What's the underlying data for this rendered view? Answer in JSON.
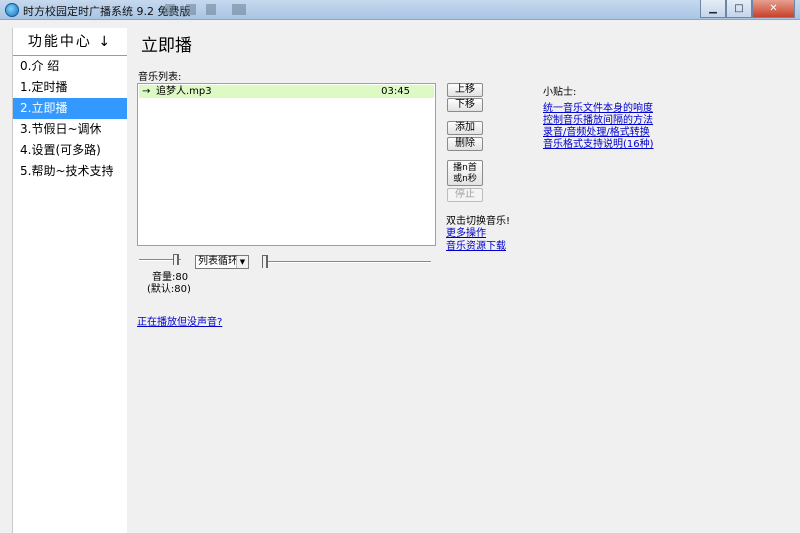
{
  "window": {
    "title": "时方校园定时广播系统 9.2 免费版",
    "buttons": {
      "minimize": "▁",
      "maximize": "□",
      "close": "✕"
    }
  },
  "sidebar": {
    "header": "功能中心",
    "header_icon": "↓",
    "items": [
      {
        "label": "0.介 绍"
      },
      {
        "label": "1.定时播"
      },
      {
        "label": "2.立即播"
      },
      {
        "label": "3.节假日~调休"
      },
      {
        "label": "4.设置(可多路)"
      },
      {
        "label": "5.帮助~技术支持"
      }
    ],
    "selected_index": 2
  },
  "main": {
    "title": "立即播",
    "list_label": "音乐列表:",
    "tracks": [
      {
        "arrow": "→",
        "name": "追梦人.mp3",
        "duration": "03:45"
      }
    ],
    "buttons": {
      "move_up": "上移",
      "move_down": "下移",
      "add": "添加",
      "delete": "删除",
      "play_first": "播n首\n或n秒",
      "stop": "停止"
    },
    "hint": "双击切换音乐!",
    "links": {
      "more_ops": "更多操作",
      "music_download": "音乐资源下载",
      "no_sound": "正在播放但没声音?"
    },
    "volume": {
      "label": "音量:80",
      "default_label": "(默认:80)",
      "value": 80
    },
    "loop_mode": {
      "selected": "列表循环",
      "arrow": "▼"
    }
  },
  "tips": {
    "title": "小贴士:",
    "links": [
      "统一音乐文件本身的响度",
      "控制音乐播放间隔的方法",
      "录音/音频处理/格式转换",
      "音乐格式支持说明(16种)"
    ]
  }
}
